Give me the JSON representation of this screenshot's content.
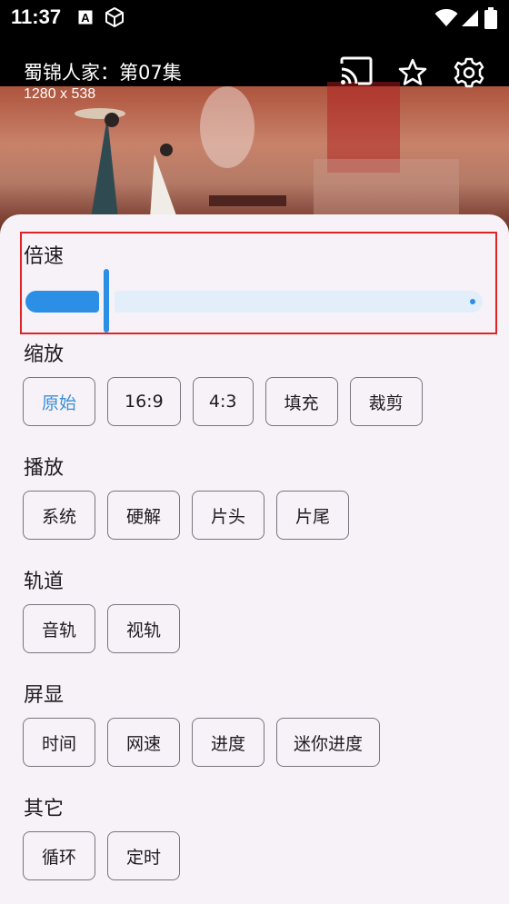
{
  "status_bar": {
    "time": "11:37"
  },
  "video": {
    "title": "蜀锦人家：第07集",
    "resolution": "1280 x 538"
  },
  "top_actions": [
    "cast-icon",
    "star-icon",
    "gear-icon"
  ],
  "speed": {
    "label": "倍速",
    "value_fraction": 0.17
  },
  "sections": {
    "zoom": {
      "label": "缩放",
      "options": [
        "原始",
        "16:9",
        "4:3",
        "填充",
        "裁剪"
      ],
      "selected": "原始"
    },
    "playback": {
      "label": "播放",
      "options": [
        "系统",
        "硬解",
        "片头",
        "片尾"
      ]
    },
    "tracks": {
      "label": "轨道",
      "options": [
        "音轨",
        "视轨"
      ]
    },
    "display": {
      "label": "屏显",
      "options": [
        "时间",
        "网速",
        "进度",
        "迷你进度"
      ]
    },
    "other": {
      "label": "其它",
      "options": [
        "循环",
        "定时"
      ]
    }
  },
  "colors": {
    "accent": "#2c8fe6",
    "highlight_box": "#e02424",
    "sheet_bg": "#f7f2f8"
  }
}
